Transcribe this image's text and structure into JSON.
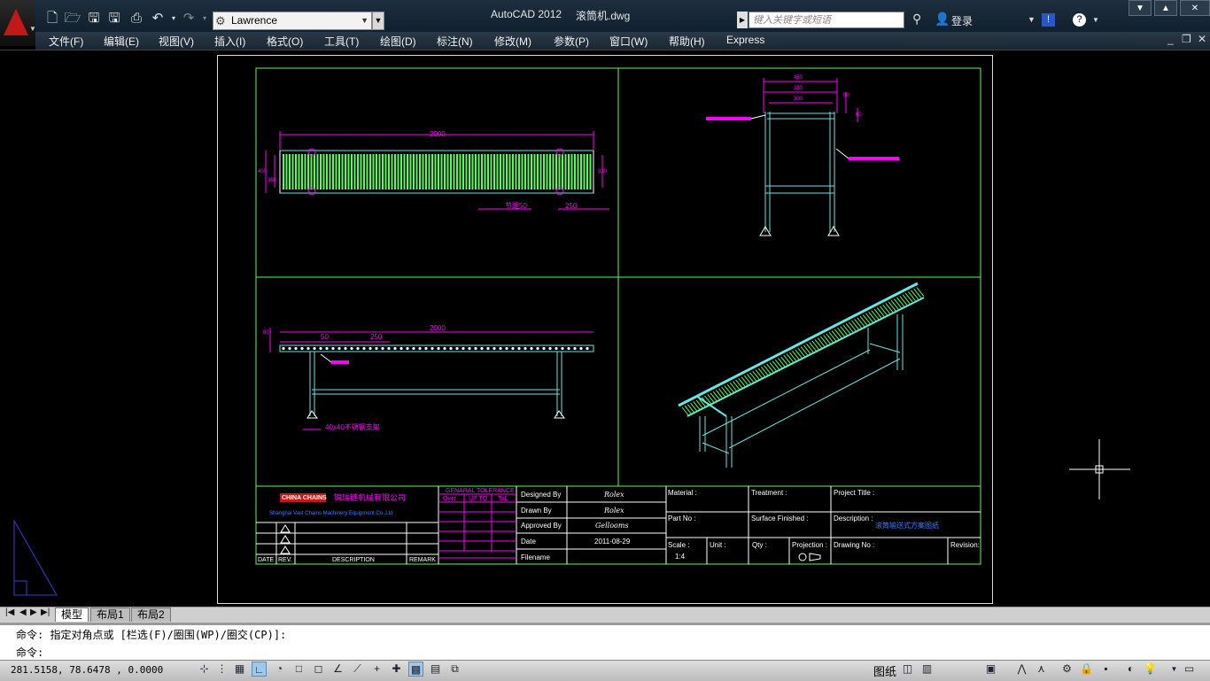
{
  "titlebar": {
    "workspace": "Lawrence",
    "app_name": "AutoCAD 2012",
    "filename": "滚筒机.dwg",
    "search_placeholder": "键入关键字或短语",
    "login_label": "登录"
  },
  "menubar": {
    "items": [
      "文件(F)",
      "编辑(E)",
      "视图(V)",
      "插入(I)",
      "格式(O)",
      "工具(T)",
      "绘图(D)",
      "标注(N)",
      "修改(M)",
      "参数(P)",
      "窗口(W)",
      "帮助(H)",
      "Express"
    ]
  },
  "drawing": {
    "dims": {
      "top_overall": "2000",
      "top_pitch": "节距50",
      "top_end": "250",
      "top_left_1": "400",
      "top_left_2": "350",
      "top_right": "330",
      "front_overall": "2000",
      "front_left": "50",
      "front_mid": "250",
      "front_left_h": "80",
      "side_top": "450",
      "side_mid": "350",
      "side_inner": "300",
      "side_r1": "80",
      "side_r2": "80",
      "leg_note": "40x40不锈钢支架"
    },
    "company_logo": "CHINA CHAINS",
    "company_cn": "锦瑞链机械有限公司",
    "company_en": "Shanghai Vast Chains Machinery Equipment Co.,Ltd"
  },
  "titleblock": {
    "tolerance_title": "GENARAL TOLERANCE",
    "tol_headers": [
      "Over",
      "UP TO",
      "ToL"
    ],
    "rev_headers": [
      "DATE",
      "REV.",
      "DESCRIPTION",
      "REMARK"
    ],
    "designed_by_label": "Designed By",
    "designed_by": "Rolex",
    "drawn_by_label": "Drawn By",
    "drawn_by": "Rolex",
    "approved_by_label": "Approved By",
    "approved_by": "Gellooms",
    "date_label": "Date",
    "date": "2011-08-29",
    "filename_label": "Filename",
    "material_label": "Material :",
    "treatment_label": "Treatment :",
    "project_title_label": "Project Title :",
    "part_no_label": "Part No :",
    "surface_label": "Surface Finished :",
    "description_label": "Description :",
    "description": "滚筒输送式方案图纸",
    "scale_label": "Scale :",
    "scale": "1:4",
    "unit_label": "Unit :",
    "qty_label": "Qty :",
    "projection_label": "Projection :",
    "drawing_no_label": "Drawing No :",
    "revision_label": "Revision:"
  },
  "tabs": {
    "model": "模型",
    "layout1": "布局1",
    "layout2": "布局2"
  },
  "command": {
    "line1": "命令: 指定对角点或 [栏选(F)/圈围(WP)/圈交(CP)]:",
    "line2": "命令:"
  },
  "status": {
    "coordinates": "281.5158, 78.6478 , 0.0000",
    "paper_label": "图纸"
  },
  "colors": {
    "green": "#52ff52",
    "magenta": "#ff00ff",
    "cyan": "#66e5e5",
    "accent_red": "#c21818"
  }
}
